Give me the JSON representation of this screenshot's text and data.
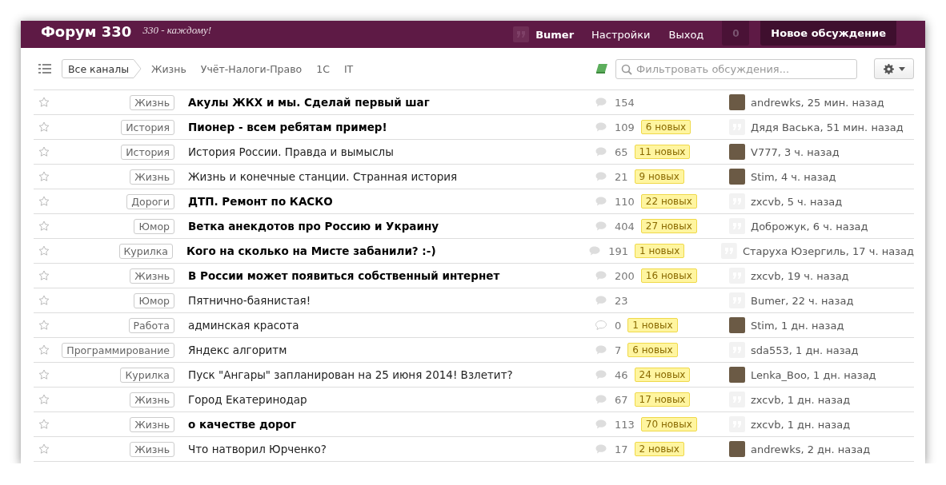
{
  "header": {
    "title": "Форум 330",
    "tagline": "330 - каждому!",
    "user": "Bumer",
    "links": [
      "Настройки",
      "Выход"
    ],
    "notifications": "0",
    "new_button": "Новое обсуждение"
  },
  "channels": [
    {
      "label": "Все каналы",
      "selected": true
    },
    {
      "label": "Жизнь",
      "selected": false
    },
    {
      "label": "Учёт-Налоги-Право",
      "selected": false
    },
    {
      "label": "1С",
      "selected": false
    },
    {
      "label": "IT",
      "selected": false
    }
  ],
  "search": {
    "placeholder": "Фильтровать обсуждения..."
  },
  "discussions": [
    {
      "starred": false,
      "category": "Жизнь",
      "title": "Акулы ЖКХ и мы. Сделай первый шаг",
      "unread": true,
      "bubble_filled": true,
      "comments": "154",
      "author": "andrewks, 25 мин. назад",
      "kind": "photo"
    },
    {
      "starred": false,
      "category": "История",
      "title": "Пионер - всем ребятам пример!",
      "unread": true,
      "bubble_filled": true,
      "comments": "109",
      "new": "6 новых",
      "author": "Дядя Васька, 51 мин. назад",
      "kind": "quote"
    },
    {
      "starred": false,
      "category": "История",
      "title": "История России. Правда и вымыслы",
      "unread": false,
      "bubble_filled": true,
      "comments": "65",
      "new": "11 новых",
      "author": "V777, 3 ч. назад",
      "kind": "photo"
    },
    {
      "starred": false,
      "category": "Жизнь",
      "title": "Жизнь и конечные станции. Странная история",
      "unread": false,
      "bubble_filled": true,
      "comments": "21",
      "new": "9 новых",
      "author": "Stim, 4 ч. назад",
      "kind": "photo"
    },
    {
      "starred": false,
      "category": "Дороги",
      "title": "ДТП. Ремонт по КАСКО",
      "unread": true,
      "bubble_filled": true,
      "comments": "110",
      "new": "22 новых",
      "author": "zxcvb, 5 ч. назад",
      "kind": "quote"
    },
    {
      "starred": false,
      "category": "Юмор",
      "title": "Ветка анекдотов про Россию и Украину",
      "unread": true,
      "bubble_filled": true,
      "comments": "404",
      "new": "27 новых",
      "author": "Доброжук, 6 ч. назад",
      "kind": "quote"
    },
    {
      "starred": false,
      "category": "Курилка",
      "title": "Кого на сколько на Мисте забанили? :-)",
      "unread": true,
      "bubble_filled": true,
      "comments": "191",
      "new": "1 новых",
      "author": "Старуха Юзергиль, 17 ч. назад",
      "kind": "quote"
    },
    {
      "starred": false,
      "category": "Жизнь",
      "title": "В России может появиться собственный интернет",
      "unread": true,
      "bubble_filled": true,
      "comments": "200",
      "new": "16 новых",
      "author": "zxcvb, 19 ч. назад",
      "kind": "quote"
    },
    {
      "starred": false,
      "category": "Юмор",
      "title": "Пятнично-баянистая!",
      "unread": false,
      "bubble_filled": true,
      "comments": "23",
      "author": "Bumer, 22 ч. назад",
      "kind": "quote"
    },
    {
      "starred": false,
      "category": "Работа",
      "title": "админская красота",
      "unread": false,
      "bubble_filled": false,
      "comments": "0",
      "new": "1 новых",
      "author": "Stim, 1 дн. назад",
      "kind": "photo"
    },
    {
      "starred": false,
      "category": "Программирование",
      "title": "Яндекс алгоритм",
      "unread": false,
      "bubble_filled": true,
      "comments": "7",
      "new": "6 новых",
      "author": "sda553, 1 дн. назад",
      "kind": "quote"
    },
    {
      "starred": false,
      "category": "Курилка",
      "title": "Пуск \"Ангары\" запланирован на 25 июня 2014! Взлетит?",
      "unread": false,
      "bubble_filled": true,
      "comments": "46",
      "new": "24 новых",
      "author": "Lenka_Boo, 1 дн. назад",
      "kind": "photo"
    },
    {
      "starred": false,
      "category": "Жизнь",
      "title": "Город Екатеринодар",
      "unread": false,
      "bubble_filled": true,
      "comments": "67",
      "new": "17 новых",
      "author": "zxcvb, 1 дн. назад",
      "kind": "quote"
    },
    {
      "starred": false,
      "category": "Жизнь",
      "title": "о качестве дорог",
      "unread": true,
      "bubble_filled": true,
      "comments": "113",
      "new": "70 новых",
      "author": "zxcvb, 1 дн. назад",
      "kind": "quote"
    },
    {
      "starred": false,
      "category": "Жизнь",
      "title": "Что натворил Юрченко?",
      "unread": false,
      "bubble_filled": true,
      "comments": "17",
      "new": "2 новых",
      "author": "andrewks, 2 дн. назад",
      "kind": "photo"
    }
  ]
}
